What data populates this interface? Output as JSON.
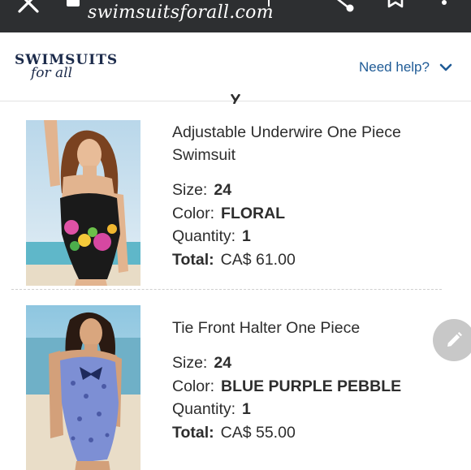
{
  "browser": {
    "url": "swimsuitsforall.com"
  },
  "header": {
    "logo_main": "SWIMSUITS",
    "logo_sub": "for all",
    "help_label": "Need help?"
  },
  "items": [
    {
      "title": "Adjustable Underwire One Piece Swimsuit",
      "size_label": "Size:",
      "size": "24",
      "color_label": "Color:",
      "color": "FLORAL",
      "quantity_label": "Quantity:",
      "quantity": "1",
      "total_label": "Total:",
      "total": "CA$ 61.00"
    },
    {
      "title": "Tie Front Halter One Piece",
      "size_label": "Size:",
      "size": "24",
      "color_label": "Color:",
      "color": "BLUE PURPLE PEBBLE",
      "quantity_label": "Quantity:",
      "quantity": "1",
      "total_label": "Total:",
      "total": "CA$ 55.00"
    }
  ],
  "icons": {
    "close": "close-icon",
    "share": "share-icon",
    "bookmark": "bookmark-icon",
    "more": "more-vertical-icon",
    "help_chevron": "chevron-down-icon",
    "edit": "pencil-icon"
  },
  "colors": {
    "browser_bar": "#2d2f31",
    "brand_navy": "#1b2a4a",
    "link_blue": "#1f5b96",
    "fab_gray": "#c8c8c8"
  }
}
